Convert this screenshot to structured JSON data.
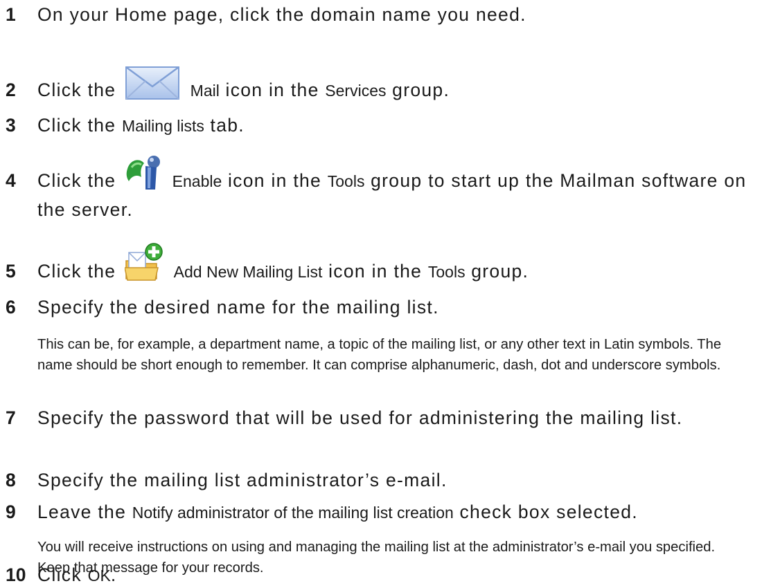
{
  "steps": [
    {
      "num": "1",
      "text": "On your Home page, click the domain name you need."
    },
    {
      "num": "2",
      "pre": "Click the",
      "ui1": "Mail",
      "mid": "icon in the",
      "ui2": "Services",
      "post": "group.",
      "icon": "mail-envelope-icon"
    },
    {
      "num": "3",
      "pre": "Click the",
      "ui1": "Mailing lists",
      "post": "tab."
    },
    {
      "num": "4",
      "pre": "Click the",
      "ui1": "Enable",
      "mid": "icon in the",
      "ui2": "Tools",
      "post": "group to start up the Mailman software on the server.",
      "icon": "enable-mailman-icon"
    },
    {
      "num": "5",
      "pre": "Click the",
      "ui1": "Add New Mailing List",
      "mid": "icon in the",
      "ui2": "Tools",
      "post": "group.",
      "icon": "add-folder-icon"
    },
    {
      "num": "6",
      "text": "Specify the desired name for the mailing list."
    },
    {
      "num": "7",
      "text": "Specify the password that will be used for administering the mailing list."
    },
    {
      "num": "8",
      "text": "Specify the mailing list administrator’s e-mail."
    },
    {
      "num": "9",
      "pre": "Leave the",
      "ui1": "Notify administrator of the mailing list creation",
      "post": "check box selected."
    },
    {
      "num": "10",
      "pre": "Click",
      "ui1": "OK",
      "post": "."
    }
  ],
  "notes": {
    "step6": "This can be, for example, a department name, a topic of the mailing list, or any other text in Latin symbols. The name should be short enough to remember. It can comprise alphanumeric, dash, dot and underscore symbols.",
    "step9": "You will receive instructions on using and managing the mailing list at the administrator’s e-mail you specified. Keep that message for your records."
  }
}
